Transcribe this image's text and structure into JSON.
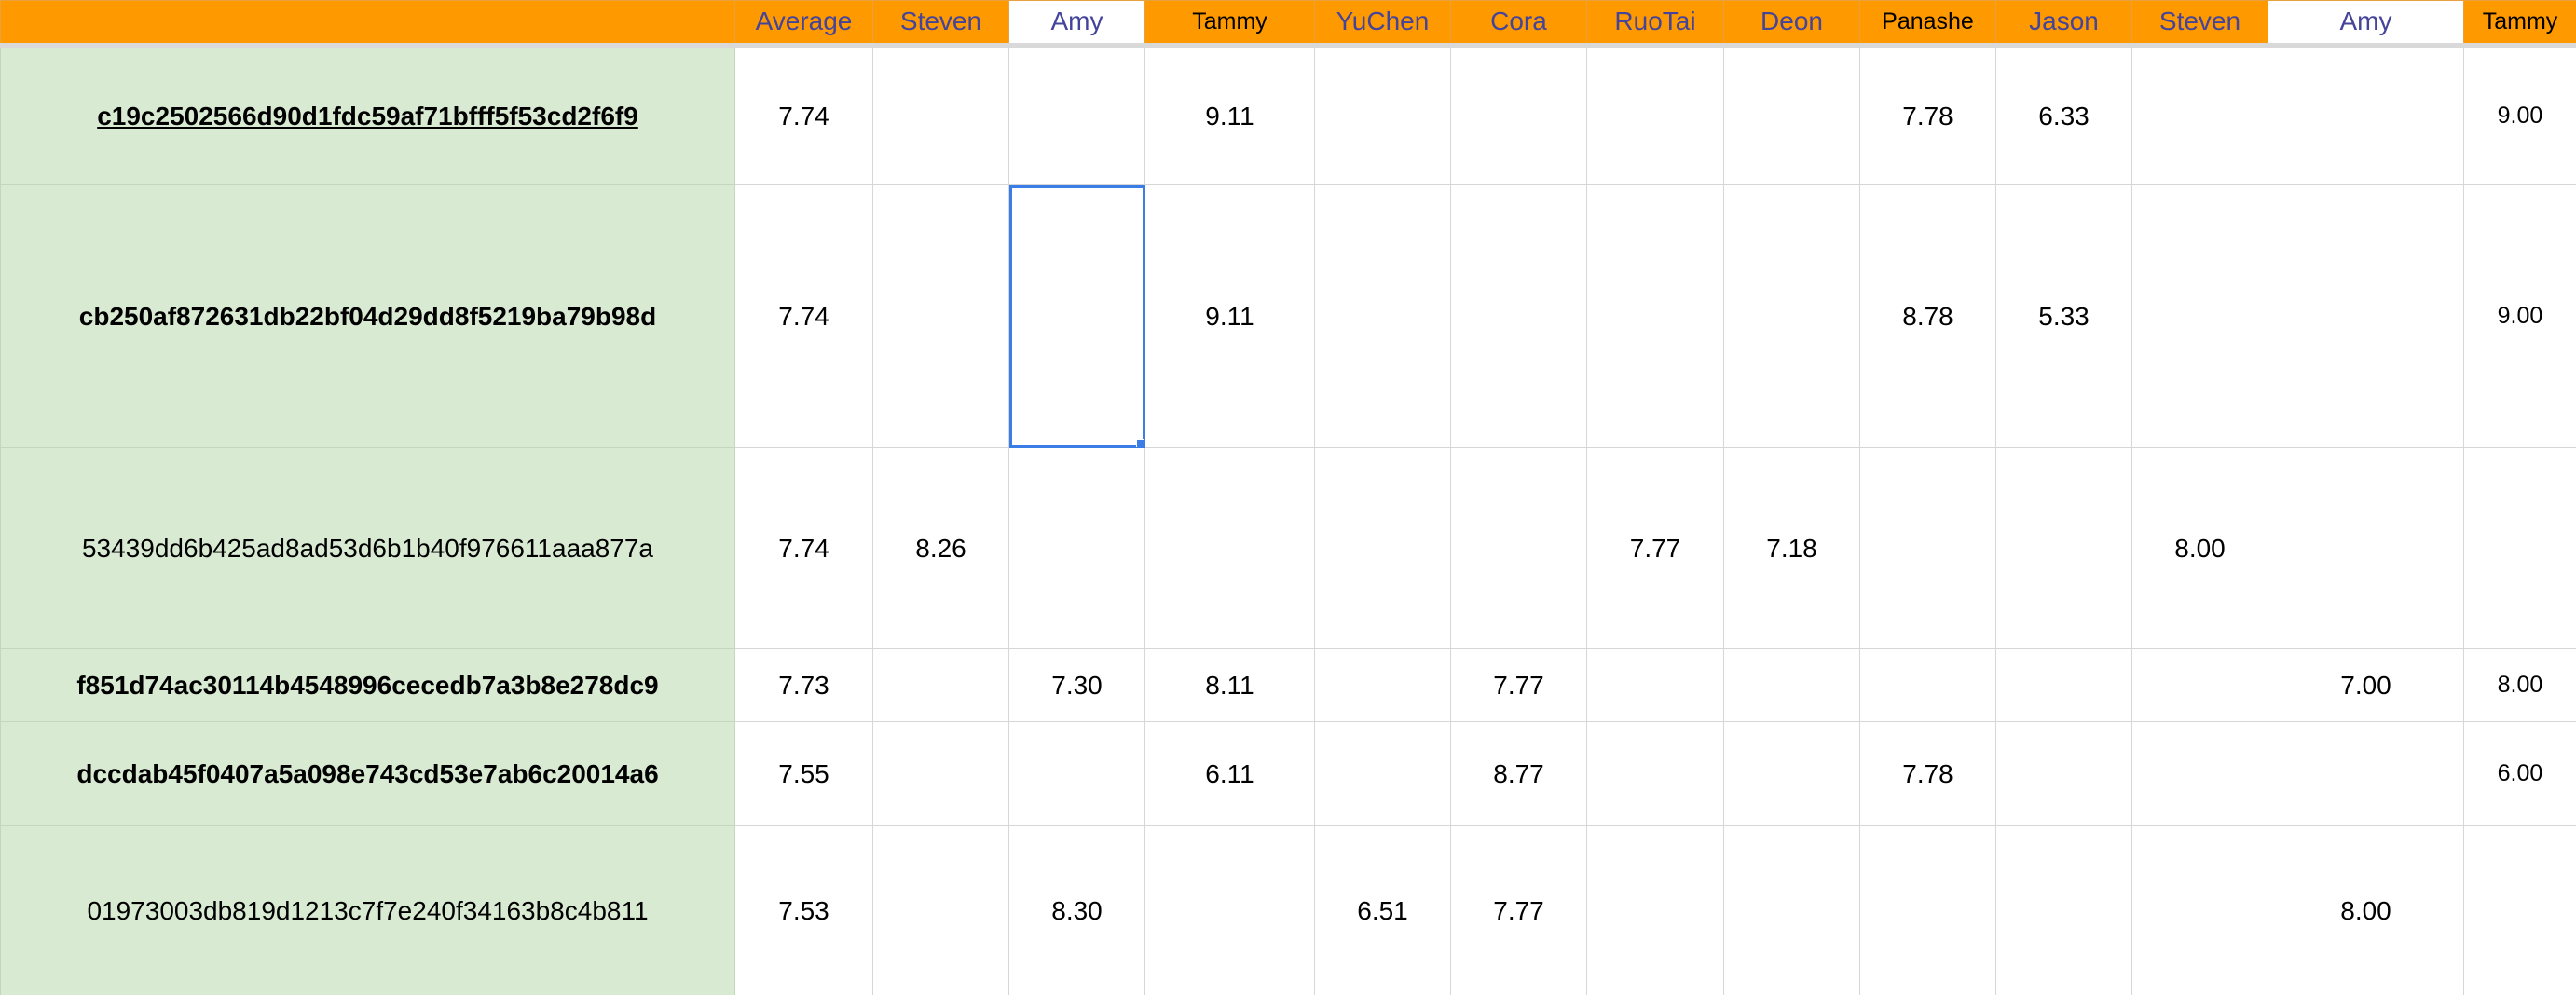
{
  "header": {
    "corner": "",
    "columns": [
      "Average",
      "Steven",
      "Amy",
      "Tammy",
      "YuChen",
      "Cora",
      "RuoTai",
      "Deon",
      "Panashe",
      "Jason",
      "Steven",
      "Amy",
      "Tammy"
    ]
  },
  "rows": [
    {
      "id": "c19c2502566d90d1fdc59af71bfff5f53cd2f6f9",
      "cells": [
        "7.74",
        "",
        "",
        "9.11",
        "",
        "",
        "",
        "",
        "7.78",
        "6.33",
        "",
        "",
        "9.00"
      ]
    },
    {
      "id": "cb250af872631db22bf04d29dd8f5219ba79b98d",
      "cells": [
        "7.74",
        "",
        "",
        "9.11",
        "",
        "",
        "",
        "",
        "8.78",
        "5.33",
        "",
        "",
        "9.00"
      ]
    },
    {
      "id": "53439dd6b425ad8ad53d6b1b40f976611aaa877a",
      "cells": [
        "7.74",
        "8.26",
        "",
        "",
        "",
        "",
        "7.77",
        "7.18",
        "",
        "",
        "8.00",
        "",
        ""
      ]
    },
    {
      "id": "f851d74ac30114b4548996cecedb7a3b8e278dc9",
      "cells": [
        "7.73",
        "",
        "7.30",
        "8.11",
        "",
        "7.77",
        "",
        "",
        "",
        "",
        "",
        "7.00",
        "8.00"
      ]
    },
    {
      "id": "dccdab45f0407a5a098e743cd53e7ab6c20014a6",
      "cells": [
        "7.55",
        "",
        "",
        "6.11",
        "",
        "8.77",
        "",
        "",
        "7.78",
        "",
        "",
        "",
        "6.00"
      ]
    },
    {
      "id": "01973003db819d1213c7f7e240f34163b8c4b811",
      "cells": [
        "7.53",
        "",
        "8.30",
        "",
        "6.51",
        "7.77",
        "",
        "",
        "",
        "",
        "",
        "8.00",
        ""
      ]
    }
  ],
  "colors": {
    "header_bg": "#ff9900",
    "header_text": "#44449a",
    "id_bg": "#d9ead3",
    "selection": "#3b7de6"
  }
}
